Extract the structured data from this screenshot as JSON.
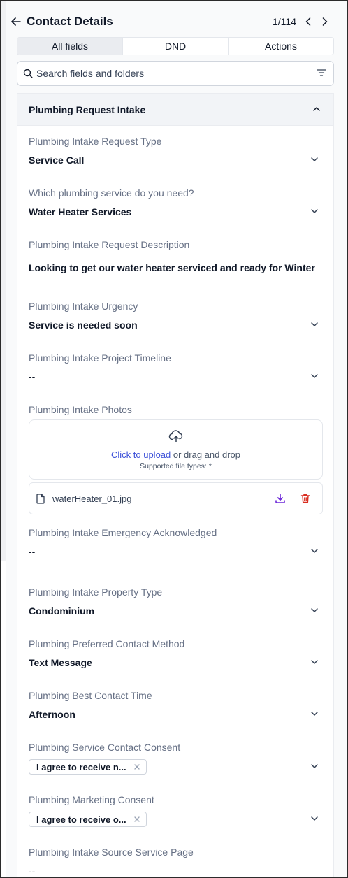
{
  "header": {
    "title": "Contact Details",
    "pager": "1/114"
  },
  "tabs": [
    {
      "label": "All fields",
      "active": true
    },
    {
      "label": "DND",
      "active": false
    },
    {
      "label": "Actions",
      "active": false
    }
  ],
  "search": {
    "placeholder": "Search fields and folders"
  },
  "section": {
    "title": "Plumbing Request Intake",
    "fields": [
      {
        "label": "Plumbing Intake Request Type",
        "value": "Service Call"
      },
      {
        "label": "Which plumbing service do you need?",
        "value": "Water Heater Services"
      },
      {
        "label": "Plumbing Intake Request Description",
        "value": "Looking to get our water heater serviced and ready for Winter"
      },
      {
        "label": "Plumbing Intake Urgency",
        "value": "Service is needed soon"
      },
      {
        "label": "Plumbing Intake Project Timeline",
        "value": "--"
      },
      {
        "label": "Plumbing Intake Photos"
      },
      {
        "label": "Plumbing Intake Emergency Acknowledged",
        "value": "--"
      },
      {
        "label": "Plumbing Intake Property Type",
        "value": "Condominium"
      },
      {
        "label": "Plumbing Preferred Contact Method",
        "value": "Text Message"
      },
      {
        "label": "Plumbing Best Contact Time",
        "value": "Afternoon"
      },
      {
        "label": "Plumbing Service Contact Consent",
        "chip": "I agree to receive n..."
      },
      {
        "label": "Plumbing Marketing Consent",
        "chip": "I agree to receive o..."
      },
      {
        "label": "Plumbing Intake Source Service Page",
        "value": "--"
      }
    ]
  },
  "upload": {
    "link_text": "Click to upload",
    "rest_text": " or drag and drop",
    "types": "Supported file types: *"
  },
  "file": {
    "name": "waterHeater_01.jpg"
  },
  "colors": {
    "link": "#3b4fd8",
    "download": "#6d28d9",
    "delete": "#d92d20"
  }
}
